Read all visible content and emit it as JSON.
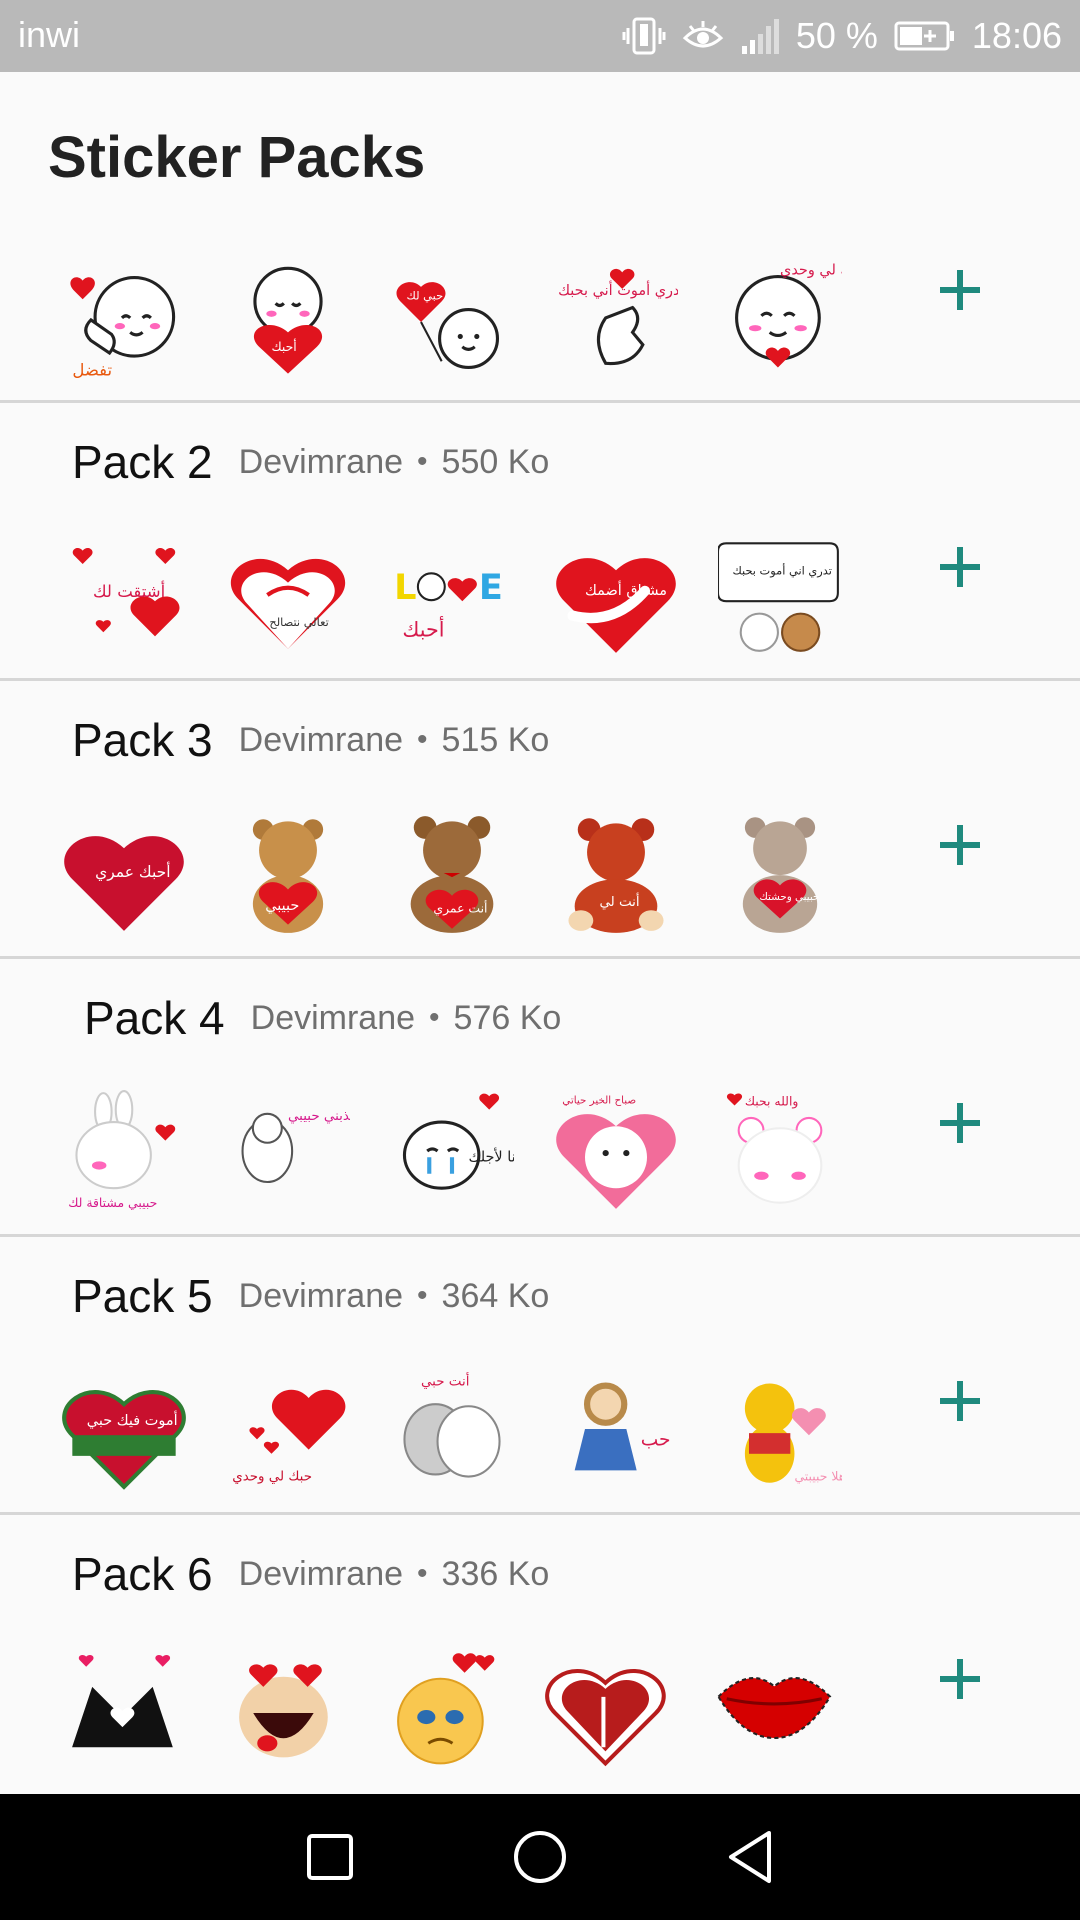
{
  "statusbar": {
    "carrier": "inwi",
    "battery": "50 %",
    "time": "18:06",
    "icons": [
      "vibrate-icon",
      "eye-comfort-icon",
      "signal-icon",
      "battery-icon"
    ]
  },
  "title": "Sticker Packs",
  "accent_color": "#1f8a7e",
  "packs": [
    {
      "name": "",
      "author": "",
      "size": "",
      "stickers": [
        "thumbs-up-heart-sticker",
        "holding-heart-sticker",
        "balloon-heart-sticker",
        "finger-heart-sticker",
        "shy-heart-sticker"
      ],
      "sticker_texts": [
        "تفضل",
        "أحبك",
        "حبي لك",
        "تدري أموت أني بحبك",
        "حبك لي وحدي"
      ]
    },
    {
      "name": "Pack 2",
      "author": "Devimrane",
      "size": "550 Ko",
      "stickers": [
        "hearts-cluster-sticker",
        "pinky-promise-heart-sticker",
        "love-text-sticker",
        "hug-heart-sticker",
        "bears-speech-bubble-sticker"
      ],
      "sticker_texts": [
        "أشتقت لك",
        "تعالي نتصالح",
        "أحبك",
        "مشتاق أضمك",
        "تدري اني أموت بحبك"
      ]
    },
    {
      "name": "Pack 3",
      "author": "Devimrane",
      "size": "515 Ko",
      "stickers": [
        "plush-heart-sticker",
        "teddy-heart-sticker",
        "brown-teddy-sticker",
        "red-teddy-sticker",
        "grey-teddy-sticker"
      ],
      "sticker_texts": [
        "أحبك عمري",
        "حبيبي",
        "أنت عمري",
        "أنت لي",
        "حبيبي وحشتك"
      ]
    },
    {
      "name": "Pack 4",
      "author": "Devimrane",
      "size": "576 Ko",
      "stickers": [
        "bunny-kiss-sticker",
        "sketch-hug-sticker",
        "crying-blob-sticker",
        "bear-heart-sticker",
        "cute-bear-sticker"
      ],
      "sticker_texts": [
        "حبيبي مشتاقة لك",
        "أنا لي عذبني حبيبي",
        "وأنا لأجلك",
        "صباح الخير حياتي",
        "والله بحبك"
      ]
    },
    {
      "name": "Pack 5",
      "author": "Devimrane",
      "size": "364 Ko",
      "stickers": [
        "ribbon-heart-sticker",
        "big-red-heart-sticker",
        "cats-hug-sticker",
        "girl-flowers-sticker",
        "pooh-heart-sticker"
      ],
      "sticker_texts": [
        "أموت فيك حبي",
        "حبك لي وحدي",
        "أنت حبي",
        "حب",
        "أهلا حبيبتي"
      ]
    },
    {
      "name": "Pack 6",
      "author": "Devimrane",
      "size": "336 Ko",
      "stickers": [
        "hands-heart-sticker",
        "heart-eyes-face-sticker",
        "crying-emoji-sticker",
        "kiss-silhouette-sticker",
        "red-lips-sticker"
      ],
      "sticker_texts": [
        "",
        "",
        "",
        "",
        ""
      ]
    }
  ],
  "navbar": {
    "icons": [
      "recents-icon",
      "home-icon",
      "back-icon"
    ]
  }
}
